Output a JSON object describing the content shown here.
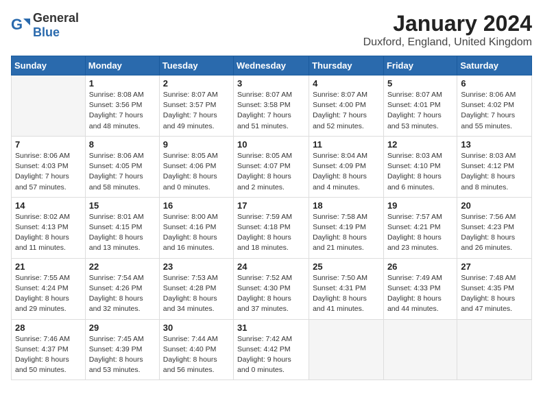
{
  "logo": {
    "general": "General",
    "blue": "Blue"
  },
  "header": {
    "month_year": "January 2024",
    "location": "Duxford, England, United Kingdom"
  },
  "days_of_week": [
    "Sunday",
    "Monday",
    "Tuesday",
    "Wednesday",
    "Thursday",
    "Friday",
    "Saturday"
  ],
  "weeks": [
    [
      {
        "day": "",
        "info": ""
      },
      {
        "day": "1",
        "info": "Sunrise: 8:08 AM\nSunset: 3:56 PM\nDaylight: 7 hours\nand 48 minutes."
      },
      {
        "day": "2",
        "info": "Sunrise: 8:07 AM\nSunset: 3:57 PM\nDaylight: 7 hours\nand 49 minutes."
      },
      {
        "day": "3",
        "info": "Sunrise: 8:07 AM\nSunset: 3:58 PM\nDaylight: 7 hours\nand 51 minutes."
      },
      {
        "day": "4",
        "info": "Sunrise: 8:07 AM\nSunset: 4:00 PM\nDaylight: 7 hours\nand 52 minutes."
      },
      {
        "day": "5",
        "info": "Sunrise: 8:07 AM\nSunset: 4:01 PM\nDaylight: 7 hours\nand 53 minutes."
      },
      {
        "day": "6",
        "info": "Sunrise: 8:06 AM\nSunset: 4:02 PM\nDaylight: 7 hours\nand 55 minutes."
      }
    ],
    [
      {
        "day": "7",
        "info": "Sunrise: 8:06 AM\nSunset: 4:03 PM\nDaylight: 7 hours\nand 57 minutes."
      },
      {
        "day": "8",
        "info": "Sunrise: 8:06 AM\nSunset: 4:05 PM\nDaylight: 7 hours\nand 58 minutes."
      },
      {
        "day": "9",
        "info": "Sunrise: 8:05 AM\nSunset: 4:06 PM\nDaylight: 8 hours\nand 0 minutes."
      },
      {
        "day": "10",
        "info": "Sunrise: 8:05 AM\nSunset: 4:07 PM\nDaylight: 8 hours\nand 2 minutes."
      },
      {
        "day": "11",
        "info": "Sunrise: 8:04 AM\nSunset: 4:09 PM\nDaylight: 8 hours\nand 4 minutes."
      },
      {
        "day": "12",
        "info": "Sunrise: 8:03 AM\nSunset: 4:10 PM\nDaylight: 8 hours\nand 6 minutes."
      },
      {
        "day": "13",
        "info": "Sunrise: 8:03 AM\nSunset: 4:12 PM\nDaylight: 8 hours\nand 8 minutes."
      }
    ],
    [
      {
        "day": "14",
        "info": "Sunrise: 8:02 AM\nSunset: 4:13 PM\nDaylight: 8 hours\nand 11 minutes."
      },
      {
        "day": "15",
        "info": "Sunrise: 8:01 AM\nSunset: 4:15 PM\nDaylight: 8 hours\nand 13 minutes."
      },
      {
        "day": "16",
        "info": "Sunrise: 8:00 AM\nSunset: 4:16 PM\nDaylight: 8 hours\nand 16 minutes."
      },
      {
        "day": "17",
        "info": "Sunrise: 7:59 AM\nSunset: 4:18 PM\nDaylight: 8 hours\nand 18 minutes."
      },
      {
        "day": "18",
        "info": "Sunrise: 7:58 AM\nSunset: 4:19 PM\nDaylight: 8 hours\nand 21 minutes."
      },
      {
        "day": "19",
        "info": "Sunrise: 7:57 AM\nSunset: 4:21 PM\nDaylight: 8 hours\nand 23 minutes."
      },
      {
        "day": "20",
        "info": "Sunrise: 7:56 AM\nSunset: 4:23 PM\nDaylight: 8 hours\nand 26 minutes."
      }
    ],
    [
      {
        "day": "21",
        "info": "Sunrise: 7:55 AM\nSunset: 4:24 PM\nDaylight: 8 hours\nand 29 minutes."
      },
      {
        "day": "22",
        "info": "Sunrise: 7:54 AM\nSunset: 4:26 PM\nDaylight: 8 hours\nand 32 minutes."
      },
      {
        "day": "23",
        "info": "Sunrise: 7:53 AM\nSunset: 4:28 PM\nDaylight: 8 hours\nand 34 minutes."
      },
      {
        "day": "24",
        "info": "Sunrise: 7:52 AM\nSunset: 4:30 PM\nDaylight: 8 hours\nand 37 minutes."
      },
      {
        "day": "25",
        "info": "Sunrise: 7:50 AM\nSunset: 4:31 PM\nDaylight: 8 hours\nand 41 minutes."
      },
      {
        "day": "26",
        "info": "Sunrise: 7:49 AM\nSunset: 4:33 PM\nDaylight: 8 hours\nand 44 minutes."
      },
      {
        "day": "27",
        "info": "Sunrise: 7:48 AM\nSunset: 4:35 PM\nDaylight: 8 hours\nand 47 minutes."
      }
    ],
    [
      {
        "day": "28",
        "info": "Sunrise: 7:46 AM\nSunset: 4:37 PM\nDaylight: 8 hours\nand 50 minutes."
      },
      {
        "day": "29",
        "info": "Sunrise: 7:45 AM\nSunset: 4:39 PM\nDaylight: 8 hours\nand 53 minutes."
      },
      {
        "day": "30",
        "info": "Sunrise: 7:44 AM\nSunset: 4:40 PM\nDaylight: 8 hours\nand 56 minutes."
      },
      {
        "day": "31",
        "info": "Sunrise: 7:42 AM\nSunset: 4:42 PM\nDaylight: 9 hours\nand 0 minutes."
      },
      {
        "day": "",
        "info": ""
      },
      {
        "day": "",
        "info": ""
      },
      {
        "day": "",
        "info": ""
      }
    ]
  ]
}
